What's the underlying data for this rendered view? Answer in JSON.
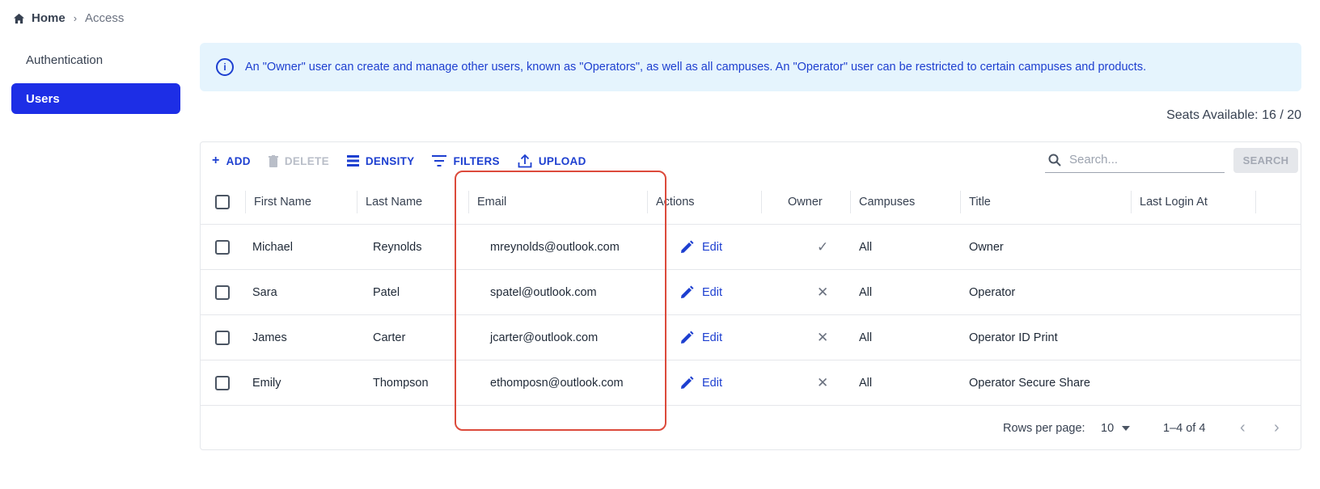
{
  "breadcrumb": {
    "home": "Home",
    "separator": "›",
    "current": "Access"
  },
  "sidebar": {
    "items": [
      {
        "label": "Authentication",
        "active": false
      },
      {
        "label": "Users",
        "active": true
      }
    ]
  },
  "info": {
    "text": "An \"Owner\" user can create and manage other users, known as \"Operators\", as well as all campuses. An \"Operator\" user can be restricted to certain campuses and products."
  },
  "seats": "Seats Available: 16 / 20",
  "toolbar": {
    "add": "ADD",
    "delete": "DELETE",
    "density": "DENSITY",
    "filters": "FILTERS",
    "upload": "UPLOAD",
    "search_placeholder": "Search...",
    "search_button": "SEARCH"
  },
  "columns": {
    "first": "First Name",
    "last": "Last Name",
    "email": "Email",
    "actions": "Actions",
    "owner": "Owner",
    "campuses": "Campuses",
    "title": "Title",
    "login": "Last Login At"
  },
  "rows": [
    {
      "first": "Michael",
      "last": "Reynolds",
      "email": "mreynolds@outlook.com",
      "action": "Edit",
      "owner": "✓",
      "campuses": "All",
      "title": "Owner",
      "login": ""
    },
    {
      "first": "Sara",
      "last": "Patel",
      "email": "spatel@outlook.com",
      "action": "Edit",
      "owner": "✕",
      "campuses": "All",
      "title": "Operator",
      "login": ""
    },
    {
      "first": "James",
      "last": "Carter",
      "email": "jcarter@outlook.com",
      "action": "Edit",
      "owner": "✕",
      "campuses": "All",
      "title": "Operator ID Print",
      "login": ""
    },
    {
      "first": "Emily",
      "last": "Thompson",
      "email": "ethomposn@outlook.com",
      "action": "Edit",
      "owner": "✕",
      "campuses": "All",
      "title": "Operator Secure Share",
      "login": ""
    }
  ],
  "footer": {
    "rows_per_page_label": "Rows per page:",
    "rows_per_page_value": "10",
    "range": "1–4 of 4",
    "prev": "‹",
    "next": "›"
  },
  "colors": {
    "accent": "#1d2ee6",
    "link": "#1d3fd0",
    "info_bg": "#e5f4fd",
    "highlight": "#dc4a3b"
  }
}
